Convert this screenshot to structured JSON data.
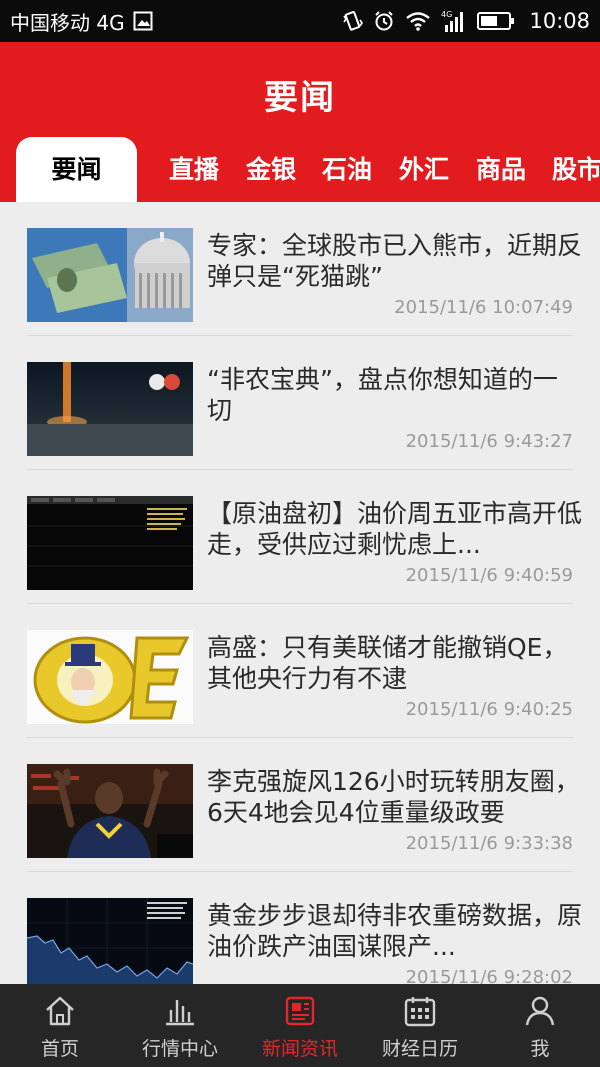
{
  "status_bar": {
    "carrier": "中国移动 4G",
    "time": "10:08"
  },
  "header": {
    "title": "要闻"
  },
  "tabs": [
    {
      "label": "要闻"
    },
    {
      "label": "直播"
    },
    {
      "label": "金银"
    },
    {
      "label": "石油"
    },
    {
      "label": "外汇"
    },
    {
      "label": "商品"
    },
    {
      "label": "股市"
    }
  ],
  "news": [
    {
      "title": "专家：全球股市已入熊市，近期反弹只是“死猫跳”",
      "date": "2015/11/6 10:07:49",
      "thumb_icon": "capitol-dollar-image"
    },
    {
      "title": "“非农宝典”，盘点你想知道的一切",
      "date": "2015/11/6 9:43:27",
      "thumb_icon": "light-beam-image"
    },
    {
      "title": "【原油盘初】油价周五亚市高开低走，受供应过剩忧虑上...",
      "date": "2015/11/6 9:40:59",
      "thumb_icon": "chart-screen-image"
    },
    {
      "title": "高盛：只有美联储才能撤销QE，其他央行力有不逮",
      "date": "2015/11/6 9:40:25",
      "thumb_icon": "qe-uncle-sam-image"
    },
    {
      "title": "李克强旋风126小时玩转朋友圈，6天4地会见4位重量级政要",
      "date": "2015/11/6 9:33:38",
      "thumb_icon": "athlete-image"
    },
    {
      "title": "黄金步步退却待非农重磅数据，原油价跌产油国谋限产...",
      "date": "2015/11/6 9:28:02",
      "thumb_icon": "price-chart-image"
    }
  ],
  "bottom_nav": [
    {
      "label": "首页",
      "icon": "home-icon",
      "active": false
    },
    {
      "label": "行情中心",
      "icon": "bar-chart-icon",
      "active": false
    },
    {
      "label": "新闻资讯",
      "icon": "news-icon",
      "active": true
    },
    {
      "label": "财经日历",
      "icon": "calendar-icon",
      "active": false
    },
    {
      "label": "我",
      "icon": "user-icon",
      "active": false
    }
  ],
  "colors": {
    "brand_red": "#e11b1e",
    "active_nav": "#e4262b"
  }
}
